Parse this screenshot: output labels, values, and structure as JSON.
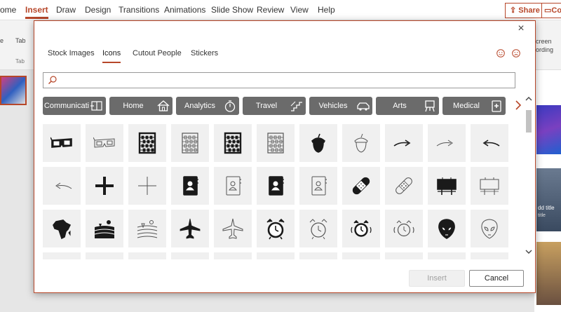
{
  "ribbon": {
    "tabs": [
      "ome",
      "Insert",
      "Draw",
      "Design",
      "Transitions",
      "Animations",
      "Slide Show",
      "Review",
      "View",
      "Help"
    ],
    "share_label": "Share",
    "comments_label": "Co",
    "left_labels": [
      "e",
      "Tab",
      "Tab"
    ],
    "right_labels": [
      "creen",
      "ording"
    ]
  },
  "right_thumbs": {
    "title_text": "dd title",
    "subtitle_text": "title"
  },
  "dialog": {
    "close_label": "×",
    "tabs": [
      "Stock Images",
      "Icons",
      "Cutout People",
      "Stickers"
    ],
    "active_tab": "Icons",
    "search": {
      "value": "",
      "placeholder": ""
    },
    "categories": [
      {
        "label": "Communicati",
        "icon": "communication-icon"
      },
      {
        "label": "Home",
        "icon": "house-icon"
      },
      {
        "label": "Analytics",
        "icon": "stopwatch-icon"
      },
      {
        "label": "Travel",
        "icon": "stairs-icon"
      },
      {
        "label": "Vehicles",
        "icon": "car-icon"
      },
      {
        "label": "Arts",
        "icon": "easel-icon"
      },
      {
        "label": "Medical",
        "icon": "medical-icon"
      }
    ],
    "icon_rows": [
      [
        "3d-glasses-filled",
        "3d-glasses-outline",
        "abacus-filled",
        "abacus-outline",
        "abacus-filled",
        "abacus-outline",
        "acorn-filled",
        "acorn-outline",
        "arrow-right-filled",
        "arrow-right-outline",
        "arrow-left-filled"
      ],
      [
        "arrow-left-outline",
        "plus-filled",
        "plus-outline",
        "address-book-filled",
        "address-book-outline",
        "address-book-filled",
        "address-book-outline",
        "bandage-filled",
        "bandage-outline",
        "billboard-filled",
        "billboard-outline"
      ],
      [
        "africa-filled",
        "farmland-filled",
        "farmland-outline",
        "airplane-filled",
        "airplane-outline",
        "alarm-clock-filled",
        "alarm-clock-outline",
        "alarm-ringing-filled",
        "alarm-ringing-outline",
        "alien-filled",
        "alien-outline"
      ]
    ],
    "insert_label": "Insert",
    "cancel_label": "Cancel"
  }
}
